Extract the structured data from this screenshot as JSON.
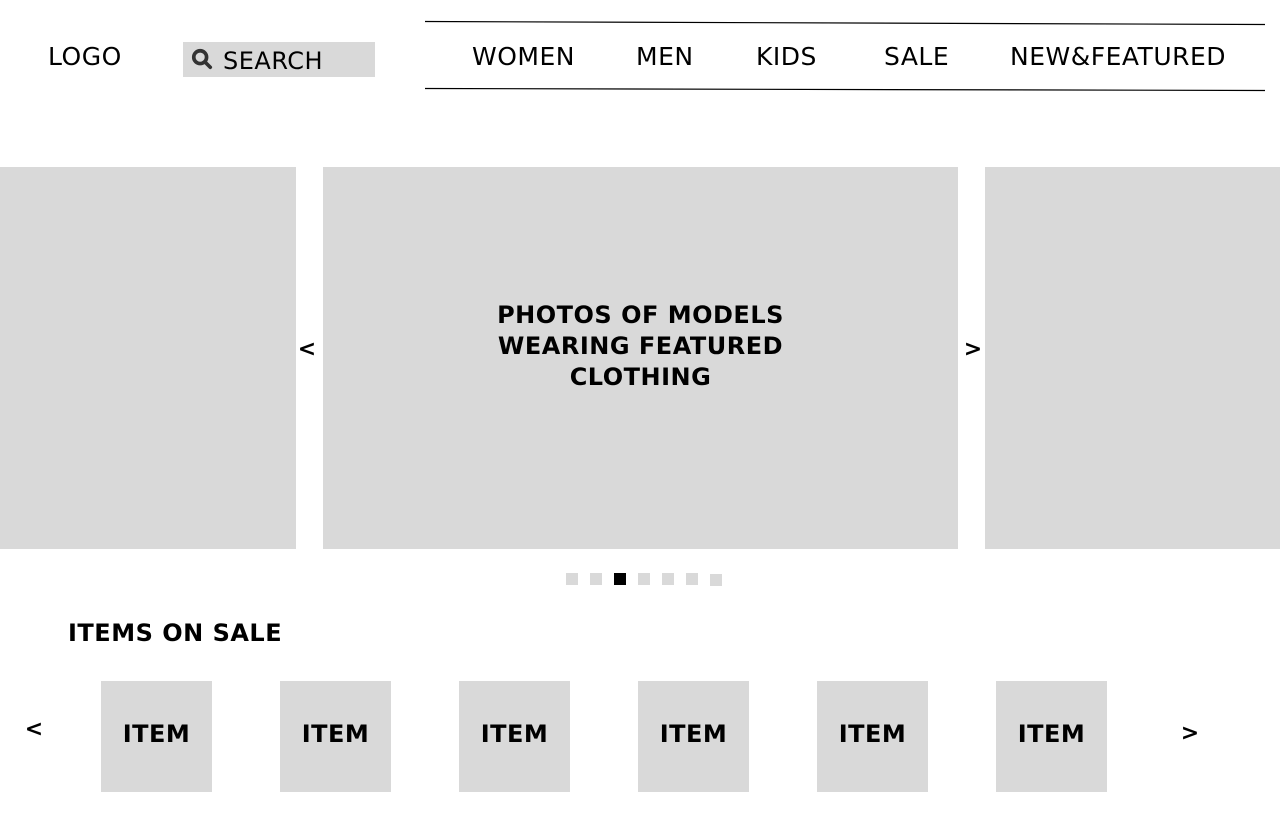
{
  "header": {
    "logo": "LOGO",
    "search": {
      "placeholder": "SEARCH",
      "icon": "search-icon"
    },
    "nav": [
      {
        "label": "WOMEN"
      },
      {
        "label": "MEN"
      },
      {
        "label": "KIDS"
      },
      {
        "label": "SALE"
      },
      {
        "label": "NEW&FEATURED"
      }
    ]
  },
  "hero": {
    "caption_lines": [
      "PHOTOS OF MODELS",
      "WEARING FEATURED",
      "CLOTHING"
    ],
    "prev_label": "<",
    "next_label": ">",
    "dots_total": 7,
    "active_dot": 3
  },
  "sale": {
    "title": "ITEMS ON SALE",
    "prev_label": "<",
    "next_label": ">",
    "items": [
      {
        "label": "ITEM"
      },
      {
        "label": "ITEM"
      },
      {
        "label": "ITEM"
      },
      {
        "label": "ITEM"
      },
      {
        "label": "ITEM"
      },
      {
        "label": "ITEM"
      }
    ]
  },
  "colors": {
    "placeholder_gray": "#d9d9d9",
    "text": "#000000",
    "active_dot": "#000000"
  }
}
